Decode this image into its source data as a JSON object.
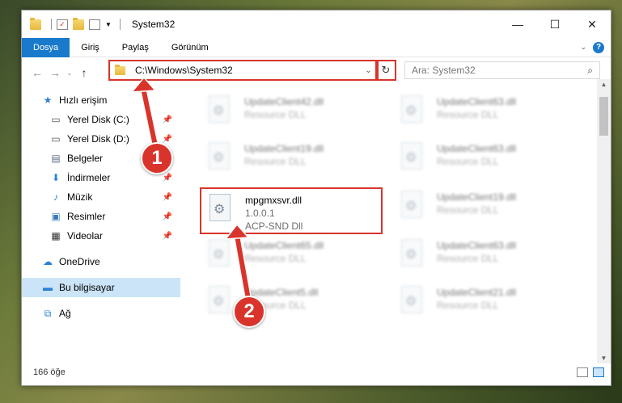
{
  "window": {
    "title": "System32",
    "controls": {
      "minimize": "—",
      "maximize": "☐",
      "close": "✕"
    }
  },
  "ribbon": {
    "tabs": [
      {
        "label": "Dosya",
        "active": true
      },
      {
        "label": "Giriş",
        "active": false
      },
      {
        "label": "Paylaş",
        "active": false
      },
      {
        "label": "Görünüm",
        "active": false
      }
    ]
  },
  "address": {
    "path": "C:\\Windows\\System32",
    "search_placeholder": "Ara: System32"
  },
  "sidebar": {
    "items": [
      {
        "label": "Hızlı erişim",
        "icon": "star-icon"
      },
      {
        "label": "Yerel Disk (C:)",
        "icon": "drive-icon",
        "pinned": true
      },
      {
        "label": "Yerel Disk (D:)",
        "icon": "drive-icon",
        "pinned": true
      },
      {
        "label": "Belgeler",
        "icon": "documents-icon",
        "pinned": true
      },
      {
        "label": "İndirmeler",
        "icon": "download-icon",
        "pinned": true
      },
      {
        "label": "Müzik",
        "icon": "music-icon",
        "pinned": true
      },
      {
        "label": "Resimler",
        "icon": "pictures-icon",
        "pinned": true
      },
      {
        "label": "Videolar",
        "icon": "videos-icon",
        "pinned": true
      },
      {
        "label": "OneDrive",
        "icon": "cloud-icon"
      },
      {
        "label": "Bu bilgisayar",
        "icon": "computer-icon",
        "selected": true
      },
      {
        "label": "Ağ",
        "icon": "network-icon"
      }
    ]
  },
  "files": {
    "left_col": [
      {
        "name": "UpdateClient42.dll",
        "desc": "Resource DLL"
      },
      {
        "name": "UpdateClient19.dll",
        "desc": "Resource DLL"
      },
      {
        "name": "mpgmxsvr.dll",
        "version": "1.0.0.1",
        "desc": "ACP-SND Dll",
        "highlighted": true
      },
      {
        "name": "UpdateClient65.dll",
        "desc": "Resource DLL"
      },
      {
        "name": "UpdateClient5.dll",
        "desc": "Resource DLL"
      }
    ],
    "right_col": [
      {
        "name": "UpdateClient63.dll",
        "desc": "Resource DLL"
      },
      {
        "name": "UpdateClient63.dll",
        "desc": "Resource DLL"
      },
      {
        "name": "UpdateClient19.dll",
        "desc": "Resource DLL"
      },
      {
        "name": "UpdateClient63.dll",
        "desc": "Resource DLL"
      },
      {
        "name": "UpdateClient21.dll",
        "desc": "Resource DLL"
      }
    ]
  },
  "status": {
    "count": "166 öğe"
  },
  "annotations": {
    "step1": "1",
    "step2": "2",
    "color": "#d9342b"
  }
}
